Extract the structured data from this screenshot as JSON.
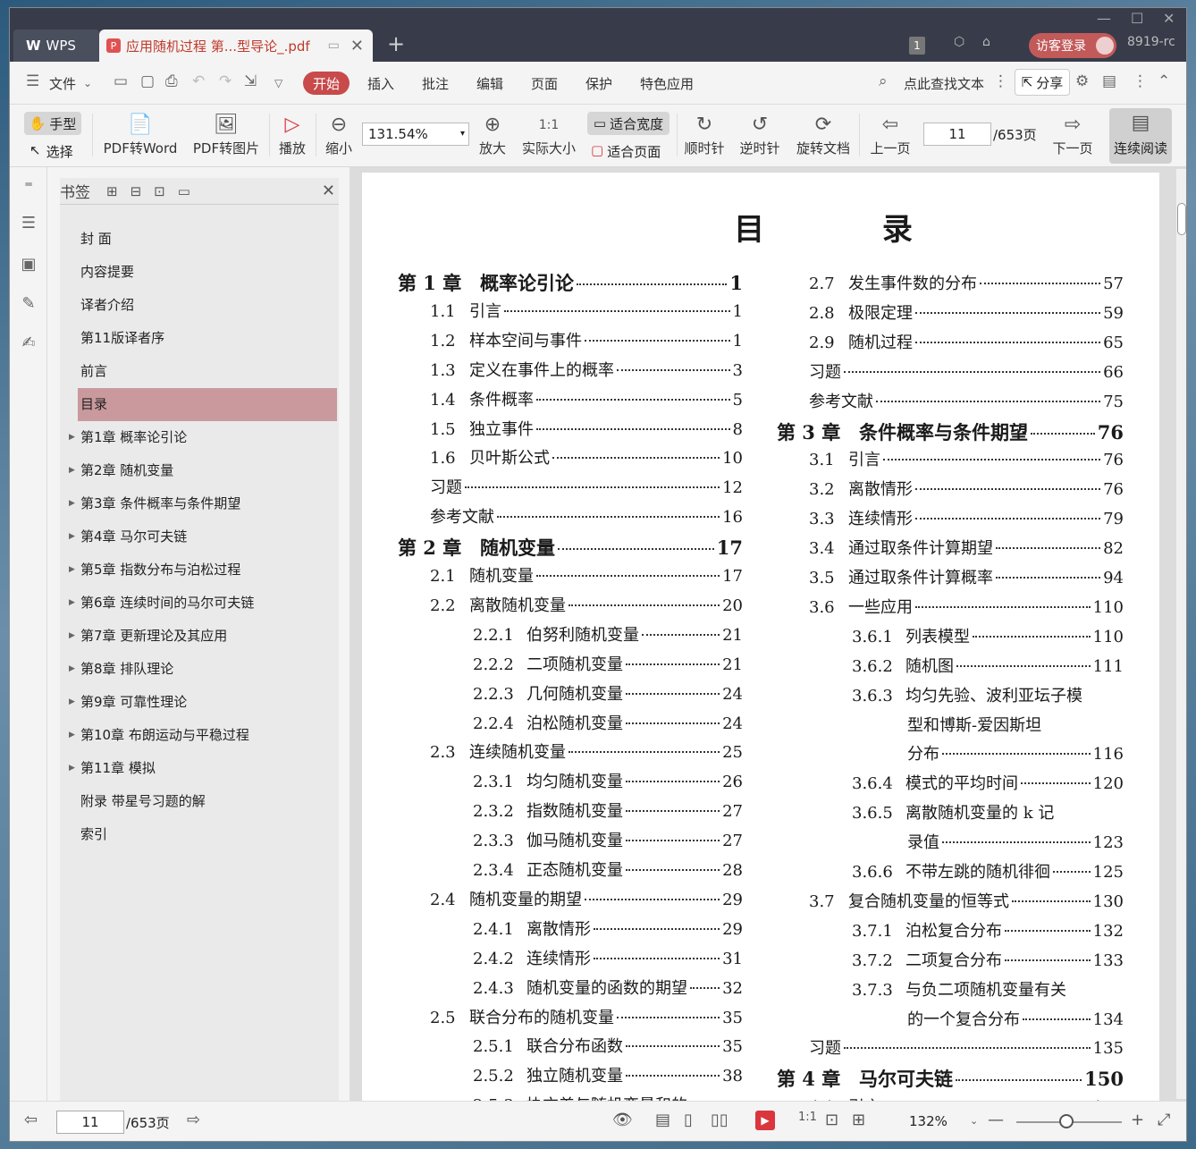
{
  "titlebar": {
    "app_tab": "WPS",
    "doc_tab": "应用随机过程 第...型导论_.pdf",
    "badge": "1",
    "login": "访客登录",
    "user_id": "8919-rc"
  },
  "menubar": {
    "file": "文件",
    "start": "开始",
    "items": [
      "插入",
      "批注",
      "编辑",
      "页面",
      "保护",
      "特色应用"
    ],
    "search": "点此查找文本",
    "share": "分享"
  },
  "toolbar": {
    "hand": "手型",
    "select": "选择",
    "pdf2word": "PDF转Word",
    "pdf2img": "PDF转图片",
    "play": "播放",
    "zoomout": "缩小",
    "zoom": "131.54%",
    "zoomin": "放大",
    "actual": "实际大小",
    "fitwidth": "适合宽度",
    "fitpage": "适合页面",
    "cw": "顺时针",
    "ccw": "逆时针",
    "rotate": "旋转文档",
    "prev": "上一页",
    "page": "11",
    "total": "/653页",
    "next": "下一页",
    "continuous": "连续阅读"
  },
  "bookmark": {
    "title": "书签",
    "items": [
      {
        "label": "封  面",
        "expandable": false,
        "active": false
      },
      {
        "label": "内容提要",
        "expandable": false,
        "active": false
      },
      {
        "label": "译者介绍",
        "expandable": false,
        "active": false
      },
      {
        "label": "第11版译者序",
        "expandable": false,
        "active": false
      },
      {
        "label": "前言",
        "expandable": false,
        "active": false
      },
      {
        "label": "目录",
        "expandable": false,
        "active": true
      },
      {
        "label": "第1章  概率论引论",
        "expandable": true,
        "active": false
      },
      {
        "label": "第2章  随机变量",
        "expandable": true,
        "active": false
      },
      {
        "label": "第3章  条件概率与条件期望",
        "expandable": true,
        "active": false
      },
      {
        "label": "第4章  马尔可夫链",
        "expandable": true,
        "active": false
      },
      {
        "label": "第5章  指数分布与泊松过程",
        "expandable": true,
        "active": false
      },
      {
        "label": "第6章  连续时间的马尔可夫链",
        "expandable": true,
        "active": false
      },
      {
        "label": "第7章  更新理论及其应用",
        "expandable": true,
        "active": false
      },
      {
        "label": "第8章  排队理论",
        "expandable": true,
        "active": false
      },
      {
        "label": "第9章  可靠性理论",
        "expandable": true,
        "active": false
      },
      {
        "label": "第10章  布朗运动与平稳过程",
        "expandable": true,
        "active": false
      },
      {
        "label": "第11章  模拟",
        "expandable": true,
        "active": false
      },
      {
        "label": "附录  带星号习题的解",
        "expandable": false,
        "active": false
      },
      {
        "label": "索引",
        "expandable": false,
        "active": false
      }
    ]
  },
  "page": {
    "title": "目    录",
    "left": [
      {
        "num": "第 1 章",
        "text": "概率论引论",
        "page": "1",
        "level": 0
      },
      {
        "num": "1.1",
        "text": "引言",
        "page": "1",
        "level": 1
      },
      {
        "num": "1.2",
        "text": "样本空间与事件",
        "page": "1",
        "level": 1
      },
      {
        "num": "1.3",
        "text": "定义在事件上的概率",
        "page": "3",
        "level": 1
      },
      {
        "num": "1.4",
        "text": "条件概率",
        "page": "5",
        "level": 1
      },
      {
        "num": "1.5",
        "text": "独立事件",
        "page": "8",
        "level": 1
      },
      {
        "num": "1.6",
        "text": "贝叶斯公式",
        "page": "10",
        "level": 1
      },
      {
        "num": "",
        "text": "习题",
        "page": "12",
        "level": 1
      },
      {
        "num": "",
        "text": "参考文献",
        "page": "16",
        "level": 1
      },
      {
        "num": "第 2 章",
        "text": "随机变量",
        "page": "17",
        "level": 0
      },
      {
        "num": "2.1",
        "text": "随机变量",
        "page": "17",
        "level": 1
      },
      {
        "num": "2.2",
        "text": "离散随机变量",
        "page": "20",
        "level": 1
      },
      {
        "num": "2.2.1",
        "text": "伯努利随机变量",
        "page": "21",
        "level": 2
      },
      {
        "num": "2.2.2",
        "text": "二项随机变量",
        "page": "21",
        "level": 2
      },
      {
        "num": "2.2.3",
        "text": "几何随机变量",
        "page": "24",
        "level": 2
      },
      {
        "num": "2.2.4",
        "text": "泊松随机变量",
        "page": "24",
        "level": 2
      },
      {
        "num": "2.3",
        "text": "连续随机变量",
        "page": "25",
        "level": 1
      },
      {
        "num": "2.3.1",
        "text": "均匀随机变量",
        "page": "26",
        "level": 2
      },
      {
        "num": "2.3.2",
        "text": "指数随机变量",
        "page": "27",
        "level": 2
      },
      {
        "num": "2.3.3",
        "text": "伽马随机变量",
        "page": "27",
        "level": 2
      },
      {
        "num": "2.3.4",
        "text": "正态随机变量",
        "page": "28",
        "level": 2
      },
      {
        "num": "2.4",
        "text": "随机变量的期望",
        "page": "29",
        "level": 1
      },
      {
        "num": "2.4.1",
        "text": "离散情形",
        "page": "29",
        "level": 2
      },
      {
        "num": "2.4.2",
        "text": "连续情形",
        "page": "31",
        "level": 2
      },
      {
        "num": "2.4.3",
        "text": "随机变量的函数的期望",
        "page": "32",
        "level": 2
      },
      {
        "num": "2.5",
        "text": "联合分布的随机变量",
        "page": "35",
        "level": 1
      },
      {
        "num": "2.5.1",
        "text": "联合分布函数",
        "page": "35",
        "level": 2
      },
      {
        "num": "2.5.2",
        "text": "独立随机变量",
        "page": "38",
        "level": 2
      },
      {
        "num": "2.5.3",
        "text": "协方差与随机变量和的",
        "page": "",
        "level": 2
      }
    ],
    "right": [
      {
        "num": "2.7",
        "text": "发生事件数的分布",
        "page": "57",
        "level": 1
      },
      {
        "num": "2.8",
        "text": "极限定理",
        "page": "59",
        "level": 1
      },
      {
        "num": "2.9",
        "text": "随机过程",
        "page": "65",
        "level": 1
      },
      {
        "num": "",
        "text": "习题",
        "page": "66",
        "level": 1
      },
      {
        "num": "",
        "text": "参考文献",
        "page": "75",
        "level": 1
      },
      {
        "num": "第 3 章",
        "text": "条件概率与条件期望",
        "page": "76",
        "level": 0
      },
      {
        "num": "3.1",
        "text": "引言",
        "page": "76",
        "level": 1
      },
      {
        "num": "3.2",
        "text": "离散情形",
        "page": "76",
        "level": 1
      },
      {
        "num": "3.3",
        "text": "连续情形",
        "page": "79",
        "level": 1
      },
      {
        "num": "3.4",
        "text": "通过取条件计算期望",
        "page": "82",
        "level": 1
      },
      {
        "num": "3.5",
        "text": "通过取条件计算概率",
        "page": "94",
        "level": 1
      },
      {
        "num": "3.6",
        "text": "一些应用",
        "page": "110",
        "level": 1
      },
      {
        "num": "3.6.1",
        "text": "列表模型",
        "page": "110",
        "level": 2
      },
      {
        "num": "3.6.2",
        "text": "随机图",
        "page": "111",
        "level": 2
      },
      {
        "num": "3.6.3",
        "text": "均匀先验、波利亚坛子模",
        "page": "",
        "level": 2
      },
      {
        "num": "",
        "text": "型和博斯-爱因斯坦",
        "page": "",
        "level": 3
      },
      {
        "num": "",
        "text": "分布",
        "page": "116",
        "level": 3
      },
      {
        "num": "3.6.4",
        "text": "模式的平均时间",
        "page": "120",
        "level": 2
      },
      {
        "num": "3.6.5",
        "text": "离散随机变量的 k 记",
        "page": "",
        "level": 2
      },
      {
        "num": "",
        "text": "录值",
        "page": "123",
        "level": 3
      },
      {
        "num": "3.6.6",
        "text": "不带左跳的随机徘徊",
        "page": "125",
        "level": 2
      },
      {
        "num": "3.7",
        "text": "复合随机变量的恒等式",
        "page": "130",
        "level": 1
      },
      {
        "num": "3.7.1",
        "text": "泊松复合分布",
        "page": "132",
        "level": 2
      },
      {
        "num": "3.7.2",
        "text": "二项复合分布",
        "page": "133",
        "level": 2
      },
      {
        "num": "3.7.3",
        "text": "与负二项随机变量有关",
        "page": "",
        "level": 2
      },
      {
        "num": "",
        "text": "的一个复合分布",
        "page": "134",
        "level": 3
      },
      {
        "num": "",
        "text": "习题",
        "page": "135",
        "level": 1
      },
      {
        "num": "第 4 章",
        "text": "马尔可夫链",
        "page": "150",
        "level": 0
      },
      {
        "num": "4.1",
        "text": "引言",
        "page": "150",
        "level": 1
      }
    ]
  },
  "statusbar": {
    "page": "11",
    "total": "/653页",
    "zoom": "132%"
  },
  "colors": {
    "accent": "#c84a4a",
    "active_bookmark": "#c9999e",
    "titlebar": "#383c4a"
  }
}
